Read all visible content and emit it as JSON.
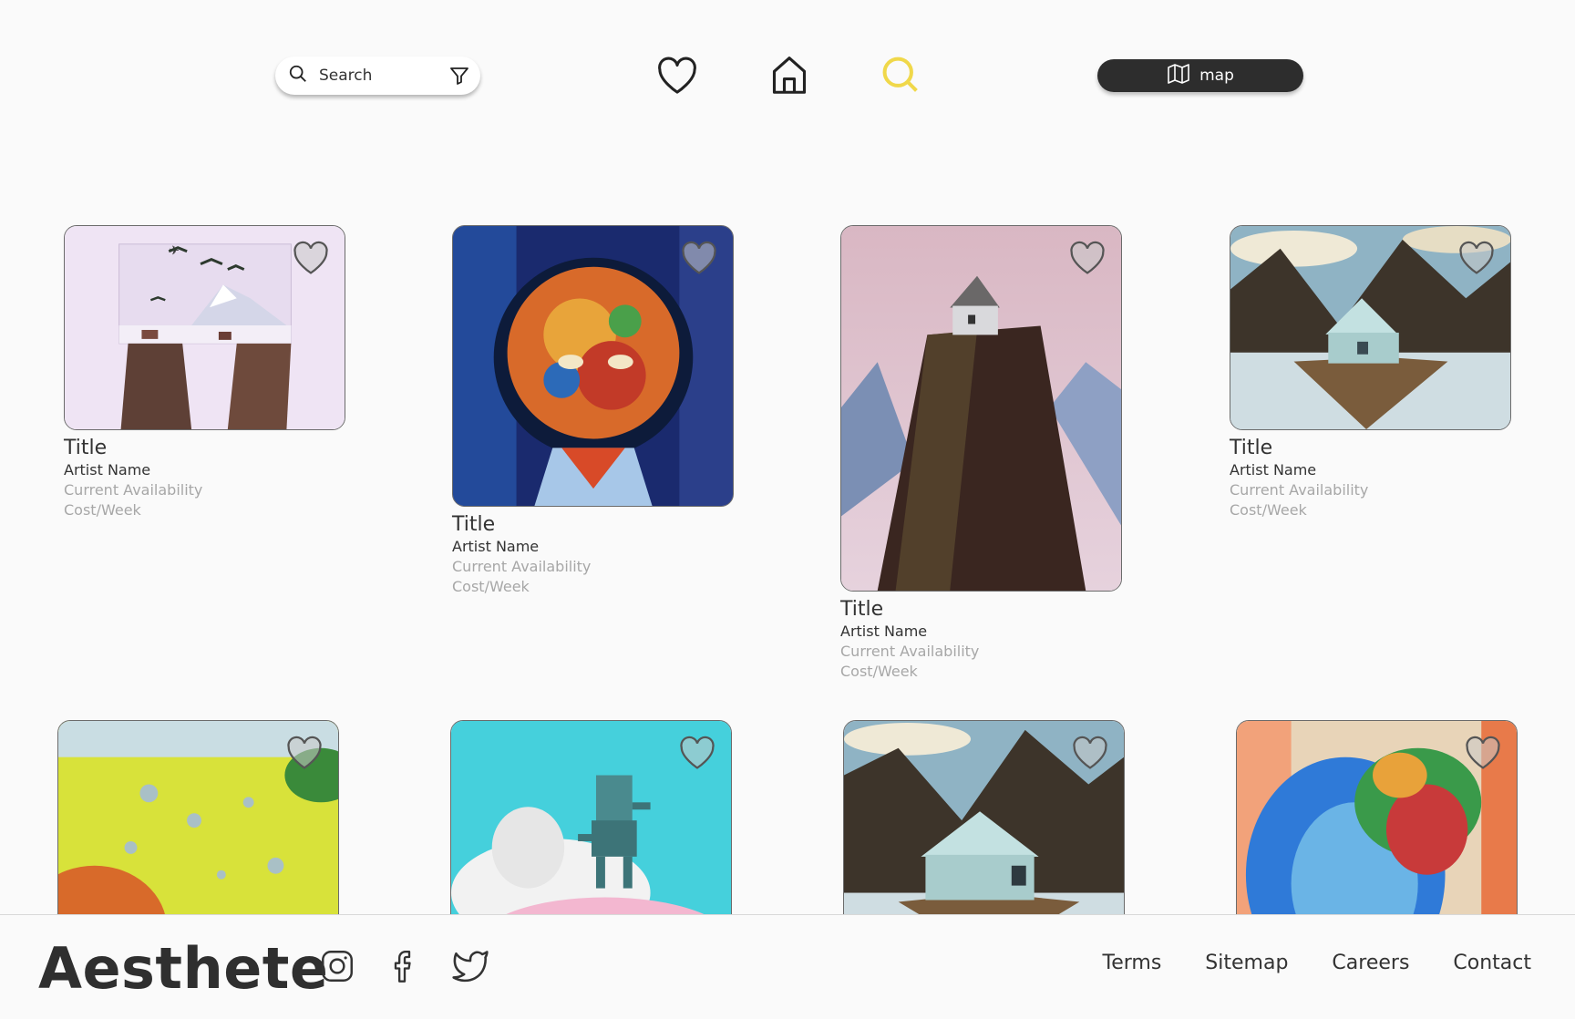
{
  "search": {
    "placeholder": "Search"
  },
  "header": {
    "icons": [
      "search-icon",
      "filter-icon",
      "heart-icon",
      "home-icon",
      "search-icon"
    ],
    "map_label": "map",
    "accent_color": "#f0d84a"
  },
  "cards": [
    {
      "title": "Title",
      "artist": "Artist Name",
      "availability": "Current Availability",
      "cost": "Cost/Week"
    },
    {
      "title": "Title",
      "artist": "Artist Name",
      "availability": "Current Availability",
      "cost": "Cost/Week"
    },
    {
      "title": "Title",
      "artist": "Artist Name",
      "availability": "Current Availability",
      "cost": "Cost/Week"
    },
    {
      "title": "Title",
      "artist": "Artist Name",
      "availability": "Current Availability",
      "cost": "Cost/Week"
    }
  ],
  "footer": {
    "brand": "Aesthete",
    "social": [
      "instagram-icon",
      "facebook-icon",
      "twitter-icon"
    ],
    "links": [
      "Terms",
      "Sitemap",
      "Careers",
      "Contact"
    ]
  }
}
